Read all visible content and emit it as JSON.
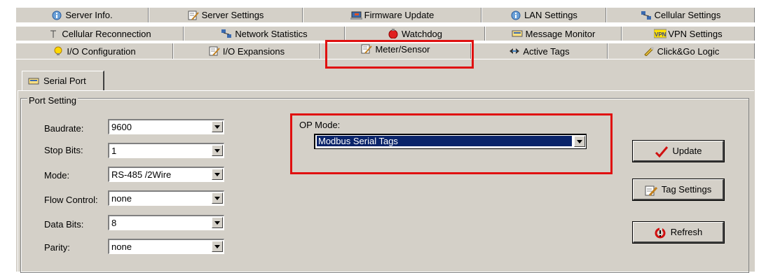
{
  "tabs": {
    "row1": [
      {
        "label": "Server Info.",
        "icon": "info-icon"
      },
      {
        "label": "Server Settings",
        "icon": "settings-icon"
      },
      {
        "label": "Firmware Update",
        "icon": "firmware-icon"
      },
      {
        "label": "LAN Settings",
        "icon": "info-icon"
      },
      {
        "label": "Cellular Settings",
        "icon": "network-icon"
      }
    ],
    "row2": [
      {
        "label": "Cellular Reconnection",
        "icon": "antenna-icon"
      },
      {
        "label": "Network Statistics",
        "icon": "network-icon"
      },
      {
        "label": "Watchdog",
        "icon": "watchdog-icon"
      },
      {
        "label": "Message Monitor",
        "icon": "message-icon"
      },
      {
        "label": "VPN Settings",
        "icon": "vpn-icon"
      }
    ],
    "row3": [
      {
        "label": "I/O Configuration",
        "icon": "bulb-icon"
      },
      {
        "label": "I/O Expansions",
        "icon": "settings-icon"
      },
      {
        "label": "Meter/Sensor",
        "icon": "settings-icon",
        "selected": true
      },
      {
        "label": "Active Tags",
        "icon": "tags-icon"
      },
      {
        "label": "Click&Go Logic",
        "icon": "logic-icon"
      }
    ]
  },
  "subtab": {
    "label": "Serial Port"
  },
  "port_setting": {
    "title": "Port Setting",
    "fields": [
      {
        "label": "Baudrate:",
        "value": "9600"
      },
      {
        "label": "Stop Bits:",
        "value": "1"
      },
      {
        "label": "Mode:",
        "value": "RS-485 /2Wire"
      },
      {
        "label": "Flow Control:",
        "value": "none"
      },
      {
        "label": "Data Bits:",
        "value": "8"
      },
      {
        "label": "Parity:",
        "value": "none"
      }
    ]
  },
  "op_mode": {
    "label": "OP Mode:",
    "value": "Modbus Serial Tags"
  },
  "buttons": {
    "update": "Update",
    "tag_settings": "Tag Settings",
    "refresh": "Refresh"
  },
  "colors": {
    "highlight": "#e01010",
    "face": "#d4d0c8",
    "selection": "#0a246a"
  }
}
